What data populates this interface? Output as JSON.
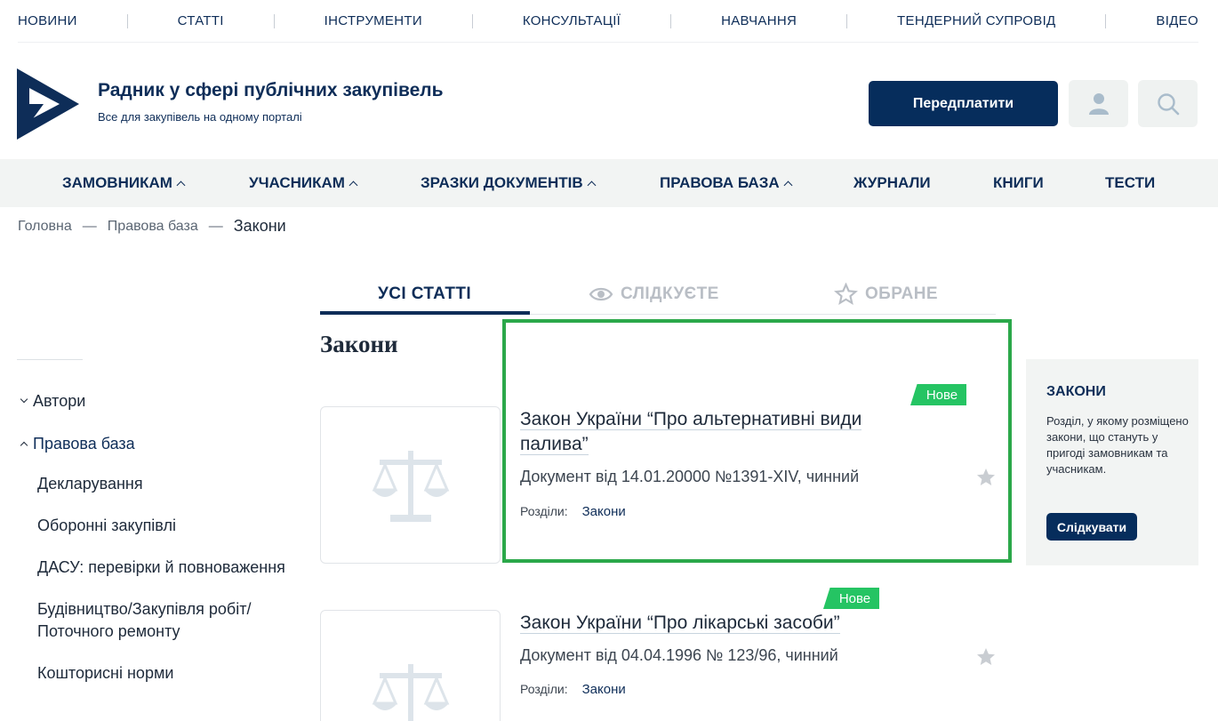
{
  "topnav": {
    "items": [
      "НОВИНИ",
      "СТАТТІ",
      "ІНСТРУМЕНТИ",
      "КОНСУЛЬТАЦІЇ",
      "НАВЧАННЯ",
      "ТЕНДЕРНИЙ СУПРОВІД",
      "ВІДЕО"
    ]
  },
  "header": {
    "title": "Радник у сфері публічних закупівель",
    "subtitle": "Все для закупівель на одному порталі",
    "subscribe_label": "Передплатити",
    "user_icon": "user-icon",
    "search_icon": "search-icon"
  },
  "mainnav": {
    "items": [
      {
        "label": "ЗАМОВНИКАМ",
        "has_dropdown": true
      },
      {
        "label": "УЧАСНИКАМ",
        "has_dropdown": true
      },
      {
        "label": "ЗРАЗКИ ДОКУМЕНТІВ",
        "has_dropdown": true
      },
      {
        "label": "ПРАВОВА БАЗА",
        "has_dropdown": true
      },
      {
        "label": "ЖУРНАЛИ",
        "has_dropdown": false
      },
      {
        "label": "КНИГИ",
        "has_dropdown": false
      },
      {
        "label": "ТЕСТИ",
        "has_dropdown": false
      }
    ]
  },
  "breadcrumb": {
    "items": [
      "Головна",
      "Правова база"
    ],
    "separator": "—",
    "current": "Закони"
  },
  "sidebar": {
    "parents": [
      "Автори",
      "Правова база"
    ],
    "children": [
      "Декларування",
      "Оборонні закупівлі",
      "ДАСУ: перевірки й повноваження",
      "Будівництво/Закупівля робіт/ Поточного ремонту",
      "Кошторисні норми"
    ]
  },
  "tabs": {
    "all": "УСІ СТАТТІ",
    "watching": "СЛІДКУЄТЕ",
    "favorites": "ОБРАНЕ"
  },
  "section_title": "Закони",
  "articles": [
    {
      "badge": "Нове",
      "title": "Закон України “Про альтернативні види палива”",
      "meta": "Документ від 14.01.20000 №1391-XIV, чинний",
      "sections_label": "Розділи:",
      "section_link": "Закони"
    },
    {
      "badge": "Нове",
      "title": "Закон України “Про лікарські засоби”",
      "meta": "Документ від 04.04.1996 № 123/96, чинний",
      "sections_label": "Розділи:",
      "section_link": "Закони"
    }
  ],
  "infobox": {
    "title": "ЗАКОНИ",
    "text": "Розділ, у якому розміщено закони, що стануть у пригоді замовникам та учасникам.",
    "button_label": "Слідкувати"
  },
  "colors": {
    "brand_navy": "#062d5c",
    "badge_green": "#25c463",
    "highlight_green": "#2ba84a",
    "nav_bg": "#f2f4f3"
  }
}
